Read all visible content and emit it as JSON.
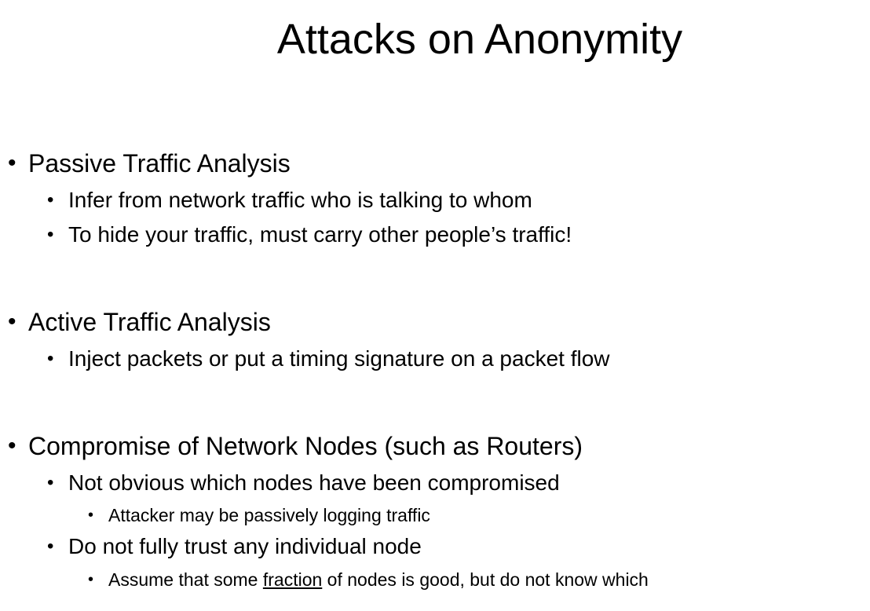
{
  "slide": {
    "title": "Attacks on Anonymity",
    "bullet_symbol": "•",
    "sections": [
      {
        "heading": "Passive Traffic Analysis",
        "items": [
          "Infer from network traffic who is talking to whom",
          "To hide your traffic, must carry other people’s traffic!"
        ]
      },
      {
        "heading": "Active Traffic Analysis",
        "items": [
          "Inject packets or put a timing signature on a packet flow"
        ]
      },
      {
        "heading": "Compromise of Network Nodes (such as Routers)",
        "items": [
          "Not obvious which nodes have been compromised",
          "Do not fully trust any individual node"
        ],
        "subitems": {
          "compromised_detail": "Attacker may be passively logging traffic",
          "trust_detail_before": "Assume that some ",
          "trust_detail_emphasis": "fraction",
          "trust_detail_after": " of nodes is good, but do not know which"
        }
      }
    ]
  }
}
